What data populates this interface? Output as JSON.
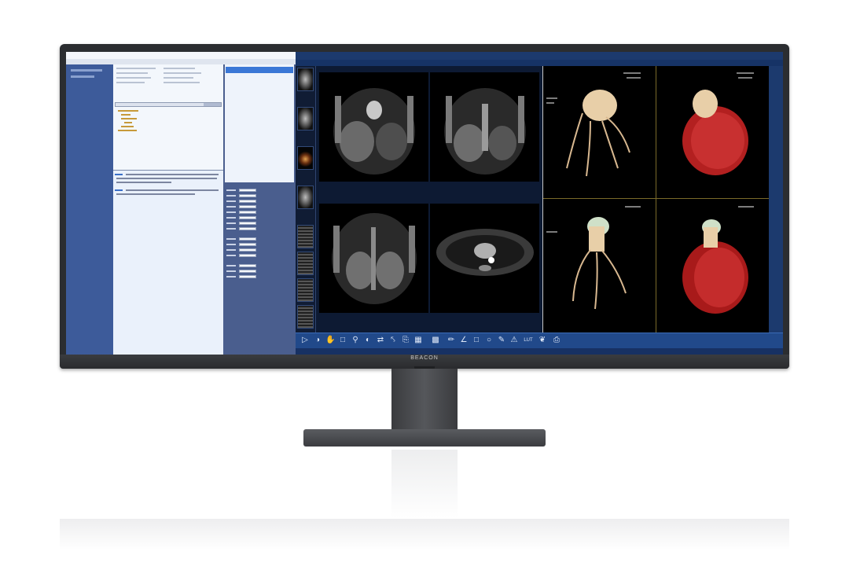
{
  "monitor": {
    "brand": "BEACON"
  },
  "left_app": {
    "title": "",
    "menu": [
      "",
      "",
      "",
      "",
      "",
      "",
      ""
    ]
  },
  "viewer": {
    "title": "",
    "menu": [
      "",
      "",
      "",
      "",
      "",
      "",
      "",
      "",
      "",
      ""
    ],
    "toolbar_icons": [
      "pointer-icon",
      "window-level-icon",
      "pan-icon",
      "crop-icon",
      "zoom-icon",
      "contrast-icon",
      "invert-icon",
      "fit-icon",
      "export-icon",
      "layout-icon",
      "grid-icon",
      "ruler-icon",
      "angle-icon",
      "rectangle-icon",
      "ellipse-icon",
      "annotate-icon",
      "text-icon",
      "lut-icon",
      "lung-icon",
      "report-icon"
    ],
    "toolbar_labels": {
      "lut": "LUT"
    }
  },
  "colors": {
    "viewer_toolbar": "#21498a",
    "nav": "#3d5b9a",
    "accent": "#3a77d6"
  }
}
